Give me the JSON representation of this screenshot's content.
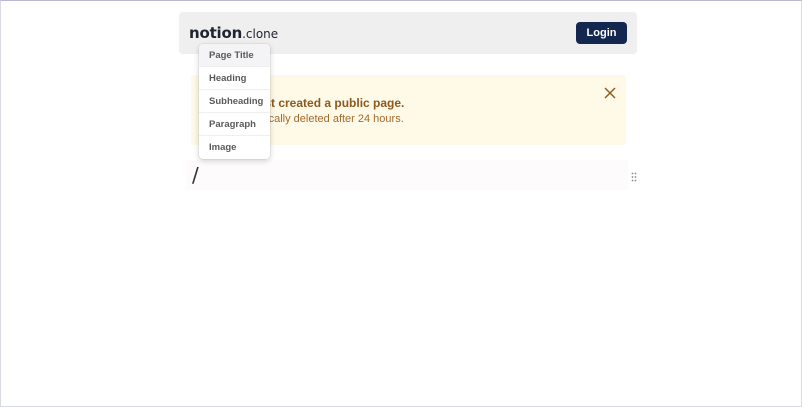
{
  "header": {
    "logo_main": "notion",
    "logo_sub": ".clone",
    "login_label": "Login"
  },
  "notice": {
    "title": "ust created a public page.",
    "description": "atically deleted after 24 hours.",
    "close_icon": "close-icon"
  },
  "editor": {
    "block_text": "/",
    "drag_icon": "drag-handle-icon"
  },
  "block_menu": {
    "items": [
      {
        "label": "Page Title"
      },
      {
        "label": "Heading"
      },
      {
        "label": "Subheading"
      },
      {
        "label": "Paragraph"
      },
      {
        "label": "Image"
      }
    ]
  },
  "colors": {
    "login_bg": "#14284f",
    "notice_bg": "#fff9e8",
    "notice_text": "#8a5a1f"
  }
}
